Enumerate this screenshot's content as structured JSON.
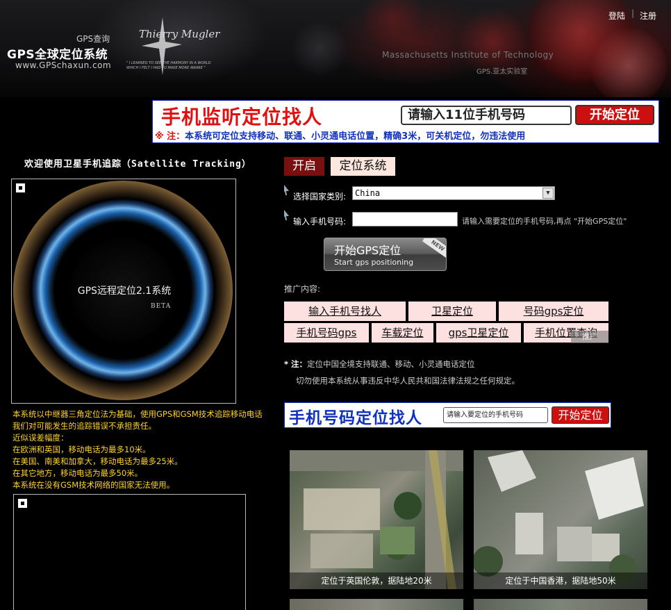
{
  "header": {
    "logo_sub": "GPS查询",
    "logo_title": "GPS全球定位系统",
    "logo_url": "www.GPSchaxun.com",
    "brand_signature": "Thierry Mugler",
    "brand_tagline": "\" I LEARNED TO SEE THE HARMONY IN A WORLD WHICH I FELT I HAD TO MAKE MORE AWARE \"",
    "institute": "Massachusetts Institute of Technology",
    "lab": "GPS.亚太实验室",
    "login": "登陆",
    "divider": "|",
    "register": "注册"
  },
  "top_banner": {
    "title": "手机监听定位找人",
    "input_prompt": "请输入11位手机号码",
    "button": "开始定位",
    "note_mark": "※ 注：",
    "note": "本系统可定位支持移动、联通、小灵通电话位置，精确3米，可关机定位，勿违法使用"
  },
  "left": {
    "welcome": "欢迎使用卫星手机追踪（Satellite Tracking）",
    "hero_title": "GPS远程定位2.1系统",
    "hero_beta": "BETA",
    "info_lines": [
      "本系统以中继器三角定位法为基础，使用GPS和GSM技术追踪移动电话",
      "我们对可能发生的追踪错误不承担责任。",
      "近似误差幅度：",
      "在欧洲和英国，移动电话为最多10米。",
      "在美国、南美和加拿大，移动电话为最多25米。",
      "在其它地方，移动电话为最多50米。",
      "本系统在没有GSM技术网络的国家无法使用。"
    ]
  },
  "right": {
    "tab_open": "开启",
    "tab_system": "定位系统",
    "country_label": "选择国家类别:",
    "country_value": "China",
    "phone_label": "输入手机号码:",
    "phone_value": "",
    "phone_hint": "请输入需要定位的手机号码,再点 \"开始GPS定位\"",
    "start_button": "开始GPS定位",
    "start_button_sub": "Start gps positioning",
    "new_badge": "NEW",
    "promo_label": "推广内容:",
    "promo_row1": [
      "输入手机号找人",
      "卫星定位",
      "号码gps定位"
    ],
    "promo_row2": [
      "手机号码gps",
      "车载定位",
      "gps卫星定位",
      "手机位置查询"
    ],
    "watermark": "推广",
    "note_star": "* 注：",
    "note_line1": "定位中国全境支持联通、移动、小灵通电话定位",
    "note_line2": "切勿使用本系统从事违反中华人民共和国法律法规之任何规定。"
  },
  "banner2": {
    "title": "手机号码定位找人",
    "input_prompt": "请输入要定位的手机号码",
    "button": "开始定位"
  },
  "photos": {
    "caption1": "定位于英国伦敦，据陆地20米",
    "caption2": "定位于中国香港，据陆地50米"
  },
  "colors": {
    "accent_red": "#cc1010",
    "banner_blue": "#1030c0",
    "info_yellow": "#ffd22a",
    "tab_dark_red": "#7a0f0f",
    "promo_pink": "#fde0e0"
  }
}
